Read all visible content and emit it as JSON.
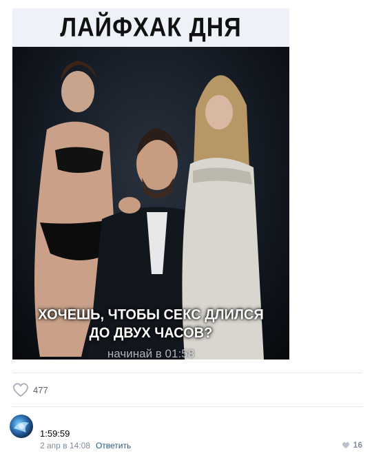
{
  "post": {
    "image_title": "ЛАЙФХАК ДНЯ",
    "image_caption_line1": "ХОЧЕШЬ, ЧТОБЫ СЕКС ДЛИЛСЯ",
    "image_caption_line2": "ДО ДВУХ ЧАСОВ?",
    "image_subcaption": "начинай в 01:58",
    "likes": "477"
  },
  "comment": {
    "text": "1:59:59",
    "date": "2 апр в 14:08",
    "reply_label": "Ответить",
    "likes": "16"
  },
  "colors": {
    "link": "#2a5885",
    "meta": "#818c99",
    "divider": "#e3e6ea"
  }
}
